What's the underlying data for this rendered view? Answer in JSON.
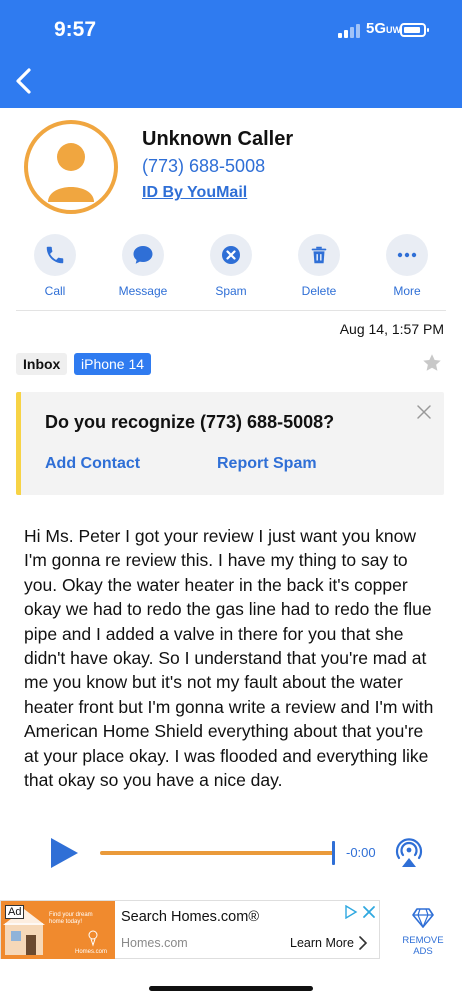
{
  "status_bar": {
    "time": "9:57",
    "network": "5G",
    "network_sub": "UW"
  },
  "caller": {
    "name": "Unknown Caller",
    "phone": "(773) 688-5008",
    "id_link": "ID By YouMail"
  },
  "actions": [
    {
      "label": "Call",
      "icon": "phone-icon"
    },
    {
      "label": "Message",
      "icon": "message-bubble-icon"
    },
    {
      "label": "Spam",
      "icon": "spam-x-icon"
    },
    {
      "label": "Delete",
      "icon": "trash-icon"
    },
    {
      "label": "More",
      "icon": "more-dots-icon"
    }
  ],
  "message": {
    "date": "Aug 14, 1:57 PM",
    "tags": [
      "Inbox",
      "iPhone 14"
    ],
    "transcript": "Hi Ms. Peter I got your review I just want you know I'm gonna re review this. I have my thing to say to you. Okay the water heater in the back it's copper okay we had to redo the gas line had to redo the flue pipe and I added a valve in there for you that she didn't have okay. So I understand that you're mad at me you know but it's not my fault about the water heater front but I'm gonna write a review and I'm with American Home Shield everything about that you're at your place okay. I was flooded and everything like that okay so you have a nice day."
  },
  "recognize_card": {
    "question": "Do you recognize (773) 688-5008?",
    "add_contact": "Add Contact",
    "report_spam": "Report Spam"
  },
  "player": {
    "time": "-0:00",
    "progress": 1.0
  },
  "ad": {
    "badge": "Ad",
    "image_text": "Find your dream home today!",
    "image_logo": "Homes.com",
    "title": "Search Homes.com®",
    "domain": "Homes.com",
    "cta": "Learn More"
  },
  "remove_ads": "REMOVE ADS",
  "colors": {
    "accent": "#2f7bf0",
    "link": "#2f6fd6",
    "avatar": "#f0a640",
    "card_bar": "#f7d345",
    "ad_image": "#f08a2e"
  }
}
